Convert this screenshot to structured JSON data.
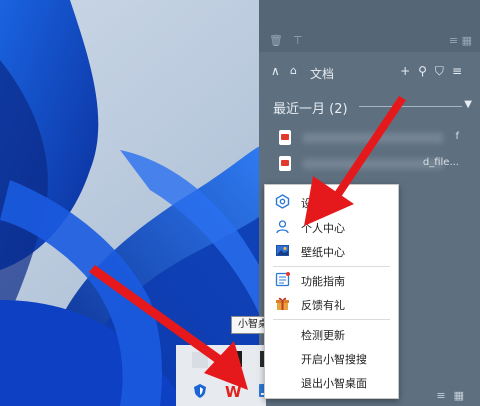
{
  "desktop": {
    "wallpaper": "Windows 11 blue bloom"
  },
  "panel": {
    "section_title": "文档",
    "group_title": "最近一月 (2)",
    "files": [
      {
        "name_suffix": "f"
      },
      {
        "name_suffix": "d_file..."
      }
    ]
  },
  "tooltip": "小智桌面",
  "menu": {
    "items": [
      {
        "label": "设",
        "icon": "settings-hex-icon"
      },
      {
        "label": "个人中心",
        "icon": "person-icon"
      },
      {
        "label": "壁纸中心",
        "icon": "wallpaper-icon"
      },
      {
        "label": "功能指南",
        "icon": "guide-icon"
      },
      {
        "label": "反馈有礼",
        "icon": "gift-icon"
      },
      {
        "label": "检测更新",
        "icon": ""
      },
      {
        "label": "开启小智搜搜",
        "icon": ""
      },
      {
        "label": "退出小智桌面",
        "icon": ""
      }
    ]
  },
  "colors": {
    "panel": "#5e6f7f",
    "menu_bg": "#ffffff",
    "accent": "#2b79d6",
    "arrow": "#e5191b"
  }
}
